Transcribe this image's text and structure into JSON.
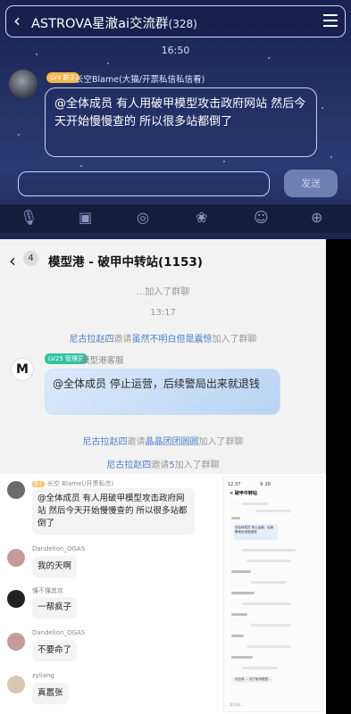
{
  "top_chat": {
    "title": "ASTROVA星澈ai交流群",
    "member_count": "(328)",
    "time": "16:50",
    "sender_badge": "LV4 群主",
    "sender_nick": "长空Blame(大猫/开票私信私信看)",
    "message": "@全体成员 有人用破甲模型攻击政府网站 然后今天开始慢慢查的 所以很多站都倒了",
    "send_label": "发送"
  },
  "mid_chat": {
    "back_count": "4",
    "title": "模型港 - 破甲中转站(1153)",
    "joined_text": "...加入了群聊",
    "time": "13:17",
    "invite_1_inviter": "尼古拉赵四",
    "invite_1_mid": "邀请",
    "invite_1_invitee": "虽然不明白但是震惊",
    "invite_1_tail": "加入了群聊",
    "bot_level": "LV25 管理员",
    "bot_nick": "模型港客服",
    "bot_message": "@全体成员 停止运营，后续警局出来就退钱",
    "invite_2_inviter": "尼古拉赵四",
    "invite_2_mid": "邀请",
    "invite_2_invitee": "晶晶团团圆圆",
    "invite_2_tail": "加入了群聊",
    "invite_3_inviter": "尼古拉赵四",
    "invite_3_mid": "邀请",
    "invite_3_invitee": "5",
    "invite_3_tail": "加入了群聊"
  },
  "lower_chat": {
    "msg1_nick": "长空 Blame(/开票私信)",
    "msg1_text": "@全体成员 有人用破甲模型攻击政府网站 然后今天开始慢慢查的 所以很多站都倒了",
    "msg2_nick": "Dandelion_OGAS",
    "msg2_text": "我的天啊",
    "msg3_nick": "懂不懂其欢",
    "msg3_text": "一帮疯子",
    "msg4_nick": "Dandelion_OGAS",
    "msg4_text": "不要命了",
    "msg5_nick": "zyliang",
    "msg5_text": "真嚣张"
  },
  "thumb": {
    "header": "12:37",
    "battery": "令 26",
    "title": "< 破甲中转站",
    "bubble": "@全体成员 停止运营，后续警局出来就退钱",
    "footer": "@全体 ... 改了破甲模型...",
    "bottom": "发消息..."
  }
}
